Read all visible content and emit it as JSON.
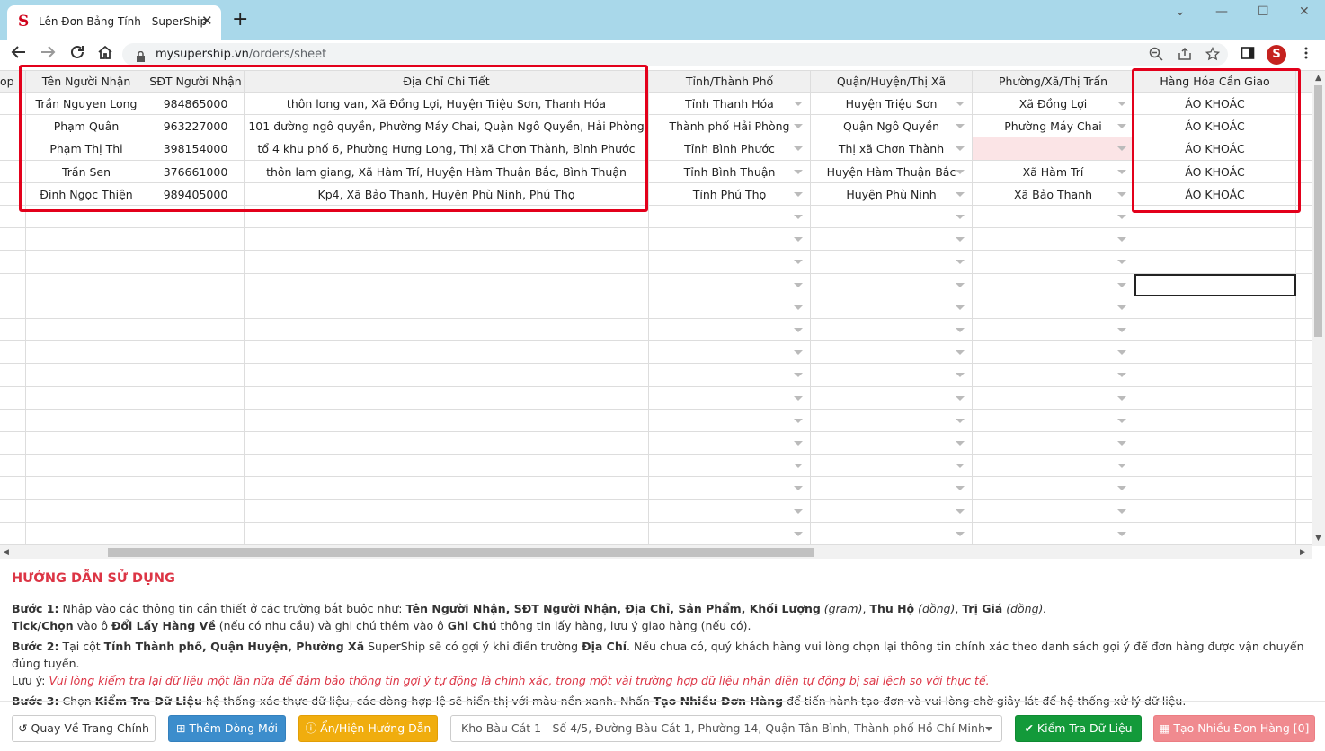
{
  "browser": {
    "tab_title": "Lên Đơn Bảng Tính - SuperShip",
    "tab_favicon": "S",
    "tab_close": "✕",
    "new_tab": "+",
    "url_host": "mysupership.vn",
    "url_path": "/orders/sheet",
    "profile_initial": "S",
    "win_minimize_glyph": "—",
    "win_maximize_glyph": "☐",
    "win_close_glyph": "✕",
    "tabs_dropdown_glyph": "⌄"
  },
  "grid": {
    "partial_header": "op",
    "headers": [
      "Tên Người Nhận",
      "SĐT Người Nhận",
      "Địa Chỉ Chi Tiết",
      "Tỉnh/Thành Phố",
      "Quận/Huyện/Thị Xã",
      "Phường/Xã/Thị Trấn",
      "Hàng Hóa Cần Giao"
    ],
    "rows": [
      [
        "Trần Nguyen Long",
        "984865000",
        "thôn long van, Xã Đồng Lợi, Huyện Triệu Sơn, Thanh Hóa",
        "Tỉnh Thanh Hóa",
        "Huyện Triệu Sơn",
        "Xã Đồng Lợi",
        "ÁO KHOÁC"
      ],
      [
        "Phạm Quân",
        "963227000",
        "101 đường ngô quyền, Phường Máy Chai, Quận Ngô Quyền, Hải Phòng",
        "Thành phố Hải Phòng",
        "Quận Ngô Quyền",
        "Phường Máy Chai",
        "ÁO KHOÁC"
      ],
      [
        "Phạm Thị Thi",
        "398154000",
        "tổ 4 khu phố 6, Phường Hưng Long, Thị xã Chơn Thành, Bình Phước",
        "Tỉnh Bình Phước",
        "Thị xã Chơn Thành",
        "",
        "ÁO KHOÁC"
      ],
      [
        "Trần Sen",
        "376661000",
        "thôn lam giang, Xã Hàm Trí, Huyện Hàm Thuận Bắc, Bình Thuận",
        "Tỉnh Bình Thuận",
        "Huyện Hàm Thuận Bắc",
        "Xã Hàm Trí",
        "ÁO KHOÁC"
      ],
      [
        "Đinh Ngọc Thiện",
        "989405000",
        "Kp4, Xã Bảo Thanh, Huyện Phù Ninh, Phú Thọ",
        "Tỉnh Phú Thọ",
        "Huyện Phù Ninh",
        "Xã Bảo Thanh",
        "ÁO KHOÁC"
      ]
    ],
    "empty_rows": 15
  },
  "guide": {
    "title": "HƯỚNG DẪN SỬ DỤNG",
    "s1_label": "Bước 1:",
    "s1_t1": " Nhập vào các thông tin cần thiết ở các trường bắt buộc như: ",
    "s1_b1": "Tên Người Nhận, SĐT Người Nhận, Địa Chỉ, Sản Phẩm, Khối Lượng",
    "s1_i1": " (gram)",
    "s1_t2": ", ",
    "s1_b2": "Thu Hộ",
    "s1_i2": " (đồng)",
    "s1_t3": ", ",
    "s1_b3": "Trị Giá",
    "s1_i3": " (đồng).",
    "s1b_b1": "Tick/Chọn",
    "s1b_t1": " vào ô ",
    "s1b_b2": "Đổi Lấy Hàng Về",
    "s1b_t2": " (nếu có nhu cầu) và ghi chú thêm vào ô ",
    "s1b_b3": "Ghi Chú",
    "s1b_t3": " thông tin lấy hàng, lưu ý giao hàng (nếu có).",
    "s2_label": "Bước 2:",
    "s2_t1": " Tại cột ",
    "s2_b1": "Tỉnh Thành phố, Quận Huyện, Phường Xã",
    "s2_t2": " SuperShip sẽ có gợi ý khi điền trường ",
    "s2_b2": "Địa Chỉ",
    "s2_t3": ". Nếu chưa có, quý khách hàng vui lòng chọn lại thông tin chính xác theo danh sách gợi ý để đơn hàng được vận chuyển đúng tuyến.",
    "note_label": "Lưu ý: ",
    "note_text": "Vui lòng kiểm tra lại dữ liệu một lần nữa để đảm bảo thông tin gợi ý tự động là chính xác, trong một vài trường hợp dữ liệu nhận diện tự động bị sai lệch so với thực tế.",
    "s3_label": "Bước 3:",
    "s3_t1": " Chọn ",
    "s3_b1": "Kiểm Tra Dữ Liệu",
    "s3_t2": " hệ thống xác thực dữ liệu, các dòng hợp lệ sẽ hiển thị với màu nền xanh. Nhấn ",
    "s3_b2": "Tạo Nhiều Đơn Hàng",
    "s3_t3": " để tiến hành tạo đơn và vui lòng chờ giây lát để hệ thống xử lý dữ liệu."
  },
  "footer": {
    "back_label": "Quay Về Trang Chính",
    "add_row_label": "Thêm Dòng Mới",
    "toggle_guide_label": "Ẩn/Hiện Hướng Dẫn",
    "warehouse_selected": "Kho Bàu Cát 1 - Số 4/5, Đường Bàu Cát 1, Phường 14, Quận Tân Bình, Thành phố Hồ Chí Minh",
    "check_data_label": "Kiểm Tra Dữ Liệu",
    "create_orders_label": "Tạo Nhiều Đơn Hàng [0]"
  },
  "colors": {
    "accent_red": "#e3001b",
    "guide_title": "#dc3545",
    "btn_blue": "#3c8dcc",
    "btn_yellow": "#f0ad0e",
    "btn_green": "#139a3a",
    "btn_red_disabled": "#f08a8f"
  },
  "icons": [
    "back-arrow-icon",
    "forward-arrow-icon",
    "reload-icon",
    "home-icon",
    "lock-icon",
    "zoom-icon",
    "share-icon",
    "star-icon",
    "sidepanel-icon",
    "menu-dots-icon",
    "undo-icon",
    "plus-square-icon",
    "info-circle-icon",
    "check-icon",
    "table-icon"
  ]
}
